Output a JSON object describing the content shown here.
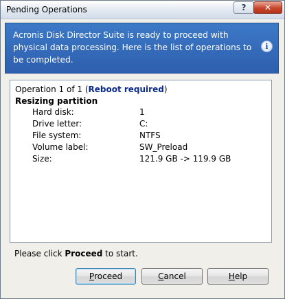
{
  "window": {
    "title": "Pending Operations",
    "help_button": "?",
    "close_button": "✕"
  },
  "banner": {
    "message": "Acronis Disk Director Suite is ready to proceed with physical data processing. Here is the list of operations to be completed.",
    "icon": "info-icon",
    "icon_glyph": "i"
  },
  "operations": {
    "counter_prefix": "Operation 1 of 1 (",
    "status": "Reboot required",
    "counter_suffix": ")",
    "section_title": "Resizing partition",
    "details": [
      {
        "label": "Hard disk:",
        "value": "1"
      },
      {
        "label": "Drive letter:",
        "value": "C:"
      },
      {
        "label": "File system:",
        "value": "NTFS"
      },
      {
        "label": "Volume label:",
        "value": "SW_Preload"
      },
      {
        "label": "Size:",
        "value": "121.9 GB -> 119.9 GB"
      }
    ]
  },
  "footer": {
    "prefix": "Please click ",
    "emphasis": "Proceed",
    "suffix": " to start."
  },
  "buttons": {
    "proceed": {
      "mnemonic": "P",
      "rest": "roceed"
    },
    "cancel": {
      "mnemonic": "C",
      "rest": "ancel"
    },
    "help": {
      "mnemonic": "H",
      "rest": "elp"
    }
  },
  "colors": {
    "banner": "#2d5fae",
    "reboot_status": "#0b2a8f",
    "close_button": "#c8452d"
  }
}
